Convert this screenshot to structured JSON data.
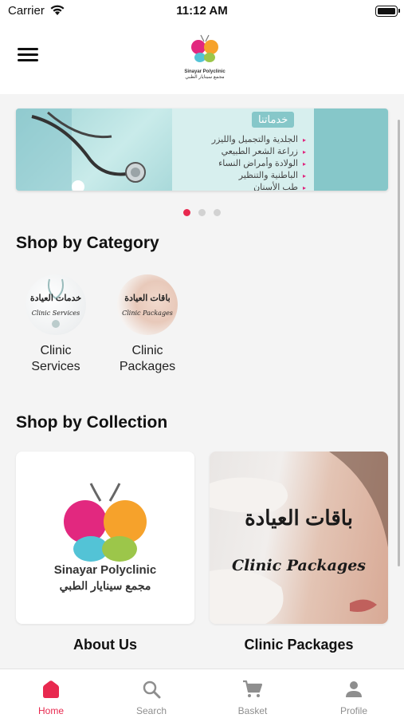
{
  "status_bar": {
    "carrier": "Carrier",
    "time": "11:12 AM"
  },
  "header": {
    "logo_name": "Sinayar Polyclinic",
    "logo_arabic": "مجمع سينايار الطبي"
  },
  "banner": {
    "title": "خدماتنا",
    "items": [
      "الجلدية والتجميل والليزر",
      "زراعة الشعر الطبيعي",
      "الولادة وأمراض النساء",
      "الباطنية والتنظير",
      "طب الأسنان"
    ],
    "active_slide": 1,
    "slide_count": 3
  },
  "categories": {
    "title": "Shop by Category",
    "items": [
      {
        "label_line1": "Clinic",
        "label_line2": "Services",
        "image_ar": "خدمات العيادة",
        "image_en": "Clinic Services"
      },
      {
        "label_line1": "Clinic",
        "label_line2": "Packages",
        "image_ar": "باقات العيادة",
        "image_en": "Clinic Packages"
      }
    ]
  },
  "collections": {
    "title": "Shop by Collection",
    "items": [
      {
        "label": "About Us",
        "logo_name": "Sinayar Polyclinic",
        "logo_arabic": "مجمع سينايار الطبي"
      },
      {
        "label": "Clinic Packages",
        "image_ar": "باقات العيادة",
        "image_en": "Clinic Packages"
      }
    ]
  },
  "tabs": [
    {
      "label": "Home",
      "icon": "home-icon",
      "active": true
    },
    {
      "label": "Search",
      "icon": "search-icon",
      "active": false
    },
    {
      "label": "Basket",
      "icon": "cart-icon",
      "active": false
    },
    {
      "label": "Profile",
      "icon": "person-icon",
      "active": false
    }
  ],
  "colors": {
    "accent": "#e8294f",
    "brand_pink": "#e2287f",
    "brand_orange": "#f6a22b",
    "brand_teal": "#53c3d6",
    "brand_green": "#9cc64a"
  }
}
